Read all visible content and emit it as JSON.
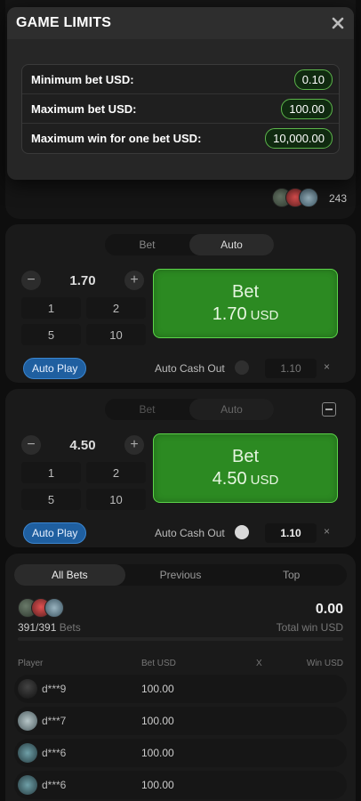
{
  "modal": {
    "title": "GAME LIMITS",
    "limits": [
      {
        "label": "Minimum bet USD:",
        "value": "0.10"
      },
      {
        "label": "Maximum bet USD:",
        "value": "100.00"
      },
      {
        "label": "Maximum win for one bet USD:",
        "value": "10,000.00"
      }
    ]
  },
  "top": {
    "player_count": "243"
  },
  "panel1": {
    "tabs": [
      "Bet",
      "Auto"
    ],
    "active_tab": "Auto",
    "amount": "1.70",
    "quick": [
      "1",
      "2",
      "5",
      "10"
    ],
    "bet_label": "Bet",
    "bet_amount": "1.70",
    "currency": "USD",
    "autoplay": "Auto Play",
    "cashout_label": "Auto Cash Out",
    "cashout_value": "1.10",
    "cashout_x": "×"
  },
  "panel2": {
    "tabs": [
      "Bet",
      "Auto"
    ],
    "active_tab": "Auto",
    "amount": "4.50",
    "quick": [
      "1",
      "2",
      "5",
      "10"
    ],
    "bet_label": "Bet",
    "bet_amount": "4.50",
    "currency": "USD",
    "autoplay": "Auto Play",
    "cashout_label": "Auto Cash Out",
    "cashout_value": "1.10",
    "cashout_x": "×"
  },
  "bets": {
    "tabs": [
      "All Bets",
      "Previous",
      "Top"
    ],
    "active_tab": "All Bets",
    "count": "391/391",
    "count_label": "Bets",
    "total_win": "0.00",
    "total_win_label": "Total win USD",
    "columns": [
      "Player",
      "Bet USD",
      "X",
      "Win USD"
    ],
    "rows": [
      {
        "player": "d***9",
        "bet": "100.00"
      },
      {
        "player": "d***7",
        "bet": "100.00"
      },
      {
        "player": "d***6",
        "bet": "100.00"
      },
      {
        "player": "d***6",
        "bet": "100.00"
      }
    ]
  }
}
